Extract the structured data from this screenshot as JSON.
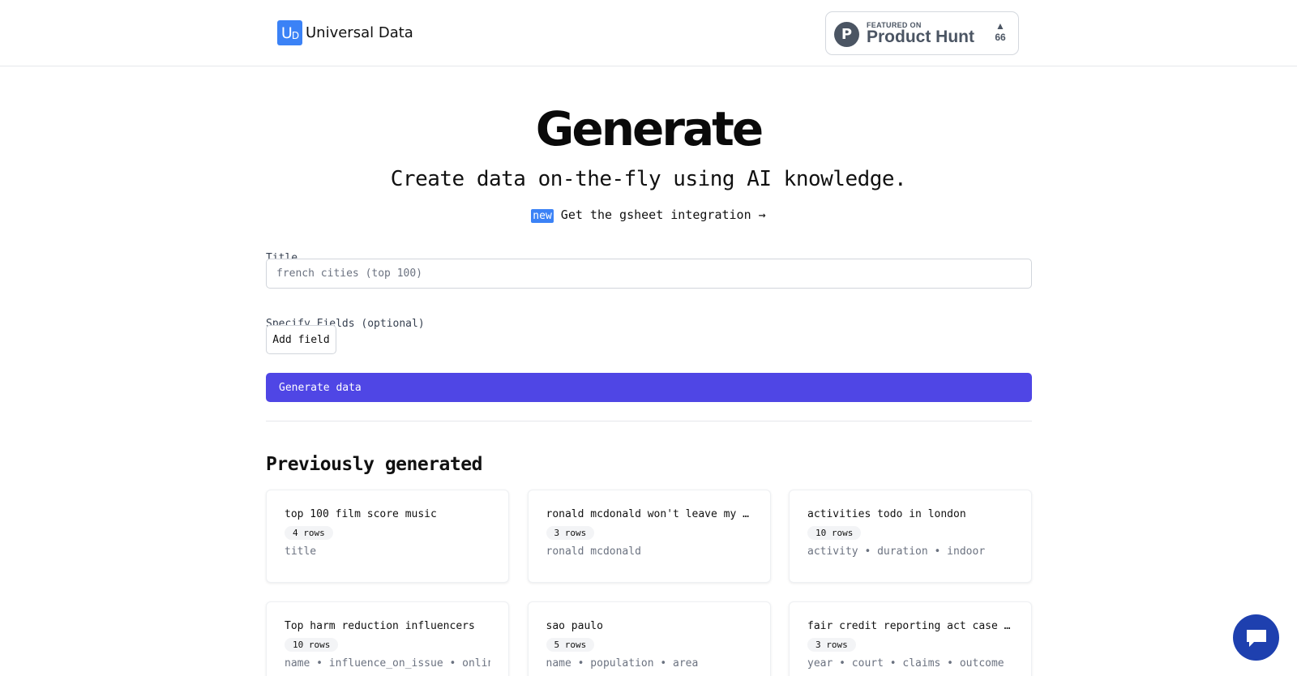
{
  "header": {
    "logo_mark": "U",
    "logo_mark_sub": "D",
    "brand": "Universal Data",
    "product_hunt": {
      "logo_letter": "P",
      "featured": "FEATURED ON",
      "name": "Product Hunt",
      "arrow": "▲",
      "votes": "66"
    }
  },
  "hero": {
    "title": "Generate",
    "subtitle": "Create data on-the-fly using AI knowledge.",
    "new_tag": "new",
    "new_link": " Get the gsheet integration →"
  },
  "form": {
    "title_label": "Title",
    "title_placeholder": "french cities (top 100)",
    "title_value": "",
    "fields_label": "Specify Fields (optional)",
    "add_field_label": "Add field",
    "generate_label": "Generate data"
  },
  "previous": {
    "heading": "Previously generated",
    "cards": [
      {
        "title": "top 100 film score music",
        "rows": "4 rows",
        "fields": "title"
      },
      {
        "title": "ronald mcdonald won't leave my bathroom",
        "rows": "3 rows",
        "fields": "ronald mcdonald"
      },
      {
        "title": "activities todo in london",
        "rows": "10 rows",
        "fields": "activity • duration • indoor"
      },
      {
        "title": "Top harm reduction influencers",
        "rows": "10 rows",
        "fields": "name • influence_on_issue • online_followers"
      },
      {
        "title": "sao paulo",
        "rows": "5 rows",
        "fields": "name • population • area"
      },
      {
        "title": "fair credit reporting act case law rulings",
        "rows": "3 rows",
        "fields": "year • court • claims • outcome"
      }
    ]
  },
  "colors": {
    "accent": "#4f46e5",
    "logo_blue": "#3b82f6",
    "chat_bubble": "#1e40af"
  },
  "icons": {
    "chat": "chat-bubble-icon",
    "product_hunt": "product-hunt-logo-icon"
  }
}
